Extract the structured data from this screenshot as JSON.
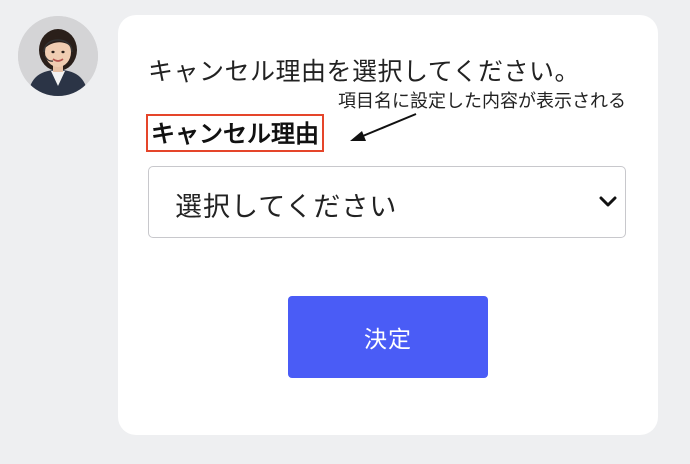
{
  "message": {
    "prompt": "キャンセル理由を選択してください。",
    "field_label": "キャンセル理由",
    "annotation": "項目名に設定した内容が表示される"
  },
  "select": {
    "value": "選択してください",
    "icon": "chevron-down-icon"
  },
  "submit_button": {
    "label": "決定"
  },
  "colors": {
    "background": "#eeeff1",
    "bubble": "#ffffff",
    "accent": "#4a5cf6",
    "highlight_border": "#e5452a"
  }
}
